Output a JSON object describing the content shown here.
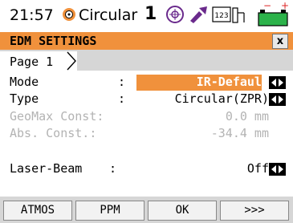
{
  "status": {
    "time": "21:57",
    "mode_label": "Circular",
    "face_number": "1",
    "icons": [
      "sun-icon",
      "level-icon",
      "laser-icon",
      "keyboard-123-icon",
      "battery-icon"
    ]
  },
  "title": {
    "text": "EDM SETTINGS",
    "close": "x"
  },
  "tab": {
    "label": "Page 1"
  },
  "fields": [
    {
      "label": "Mode",
      "colon": ":",
      "value": "IR-Default"
    },
    {
      "label": "Type",
      "colon": ":",
      "value": "Circular(ZPR)"
    },
    {
      "label": "GeoMax Const:",
      "colon": "",
      "value": "0.0 mm"
    },
    {
      "label": "Abs.  Const.:",
      "colon": "",
      "value": "-34.4 mm"
    },
    {
      "label": "Laser-Beam",
      "colon": ":",
      "value": "Off"
    }
  ],
  "softkeys": [
    "ATMOS",
    "PPM",
    "OK",
    ">>>"
  ],
  "colors": {
    "accent": "#f0913c",
    "disabled": "#b3b3b3",
    "bar": "#d6d6d6"
  }
}
